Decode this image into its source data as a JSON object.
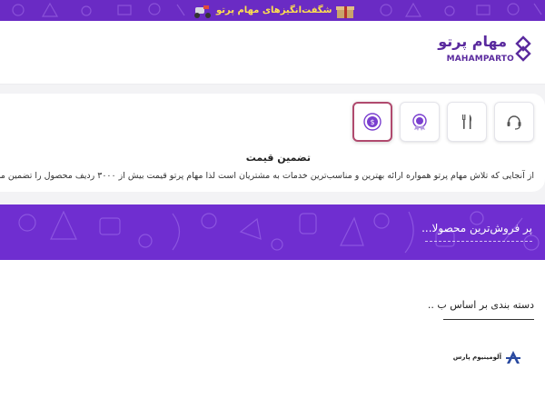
{
  "promo": {
    "text": "شگفت‌انگیزهای مهام پرتو"
  },
  "logo": {
    "persian": "مهام پرتو",
    "latin": "MAHAMPARTO"
  },
  "feature_tabs": [
    {
      "icon": "price-badge-icon",
      "active": true
    },
    {
      "icon": "quality-badge-icon",
      "active": false
    },
    {
      "icon": "fork-knife-icon",
      "active": false
    },
    {
      "icon": "headset-icon",
      "active": false
    }
  ],
  "feature": {
    "title": "تضمین قیمت",
    "description": "از آنجایی که تلاش مهام پرتو همواره ارائه بهترین و مناسب‌ترین خدمات به مشتریان است لذا مهام پرتو قیمت بیش از ۳۰۰۰ ردیف محصول را تضمین می‌کند."
  },
  "bestsellers": {
    "title": "پر فروش‌ترین محصولا..."
  },
  "categories": {
    "title": "دسته بندی بر اساس ب ..",
    "brands": [
      {
        "name": "آلومینیوم پارس",
        "icon": "aluminium-pars-logo-icon"
      }
    ]
  },
  "colors": {
    "brand_purple": "#6f2ed0",
    "logo_purple": "#5a2a9e",
    "promo_yellow": "#ffe14d",
    "active_tab_border": "#b04a6e"
  }
}
